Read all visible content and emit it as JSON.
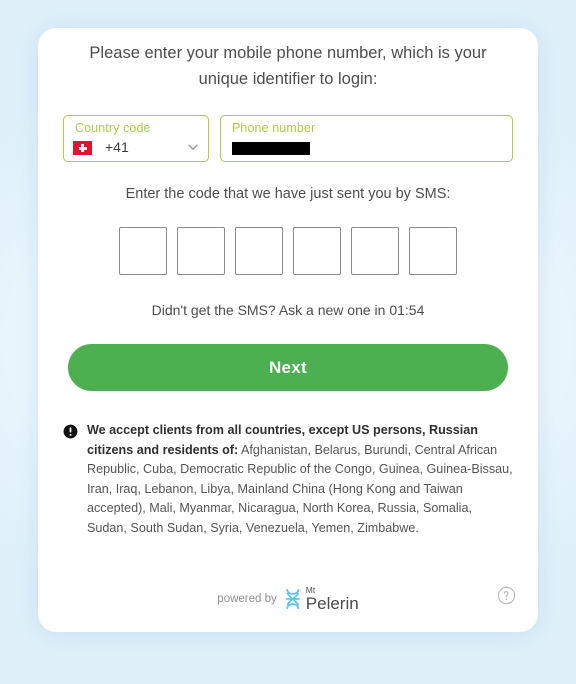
{
  "theme": {
    "accent_green": "#4caf50",
    "field_green": "#a8cf3f",
    "flag_red": "#e4122c",
    "brand_blue": "#5bc6ef",
    "text_dark": "#4d4d4d",
    "background": "#e4f3fb"
  },
  "heading": "Please enter your mobile phone number, which is your unique identifier to login:",
  "country_field": {
    "label": "Country code",
    "flag": "swiss-flag-icon",
    "dial_code": "+41",
    "chevron": "chevron-down-icon"
  },
  "phone_field": {
    "label": "Phone number",
    "value": "",
    "redacted": true
  },
  "sms": {
    "prompt": "Enter the code that we have just sent you by SMS:",
    "digits": [
      "",
      "",
      "",
      "",
      "",
      ""
    ],
    "resend_text": "Didn't get the SMS? Ask a new one in 01:54",
    "timer": "01:54"
  },
  "next_button": {
    "label": "Next"
  },
  "disclaimer": {
    "icon": "alert-circle-icon",
    "bold_part": "We accept clients from all countries, except US persons, Russian citizens and residents of:",
    "rest_part": " Afghanistan, Belarus, Burundi, Central African Republic, Cuba, Democratic Republic of the Congo, Guinea, Guinea-Bissau, Iran, Iraq, Lebanon, Libya, Mainland China (Hong Kong and Taiwan accepted), Mali, Myanmar, Nicaragua, North Korea, Russia, Somalia, Sudan, South Sudan, Syria, Venezuela, Yemen, Zimbabwe."
  },
  "footer": {
    "powered_by": "powered by",
    "brand_sup": "Mt",
    "brand_name": "Pelerin",
    "brand_mark": "mt-pelerin-logo-icon",
    "help": "help-circle-icon"
  }
}
